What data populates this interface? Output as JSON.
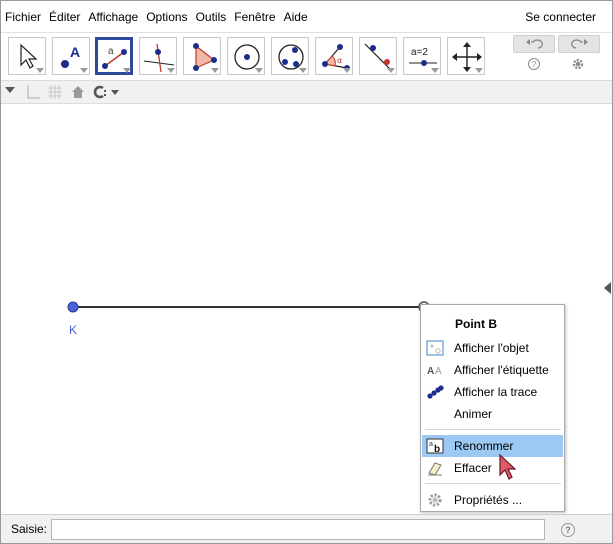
{
  "menubar": {
    "items": [
      {
        "label": "Fichier"
      },
      {
        "label": "Éditer"
      },
      {
        "label": "Affichage"
      },
      {
        "label": "Options"
      },
      {
        "label": "Outils"
      },
      {
        "label": "Fenêtre"
      },
      {
        "label": "Aide"
      }
    ],
    "connect_label": "Se connecter"
  },
  "toolbar": {
    "tools": [
      {
        "icon": "move-arrow-icon"
      },
      {
        "icon": "point-icon",
        "text": "A"
      },
      {
        "icon": "segment-icon",
        "text": "a",
        "selected": true
      },
      {
        "icon": "perpendicular-line-icon"
      },
      {
        "icon": "polygon-icon"
      },
      {
        "icon": "circle-center-point-icon"
      },
      {
        "icon": "circle-three-points-icon"
      },
      {
        "icon": "angle-icon",
        "text": "α"
      },
      {
        "icon": "reflect-line-icon"
      },
      {
        "icon": "slider-icon",
        "text": "a=2"
      },
      {
        "icon": "move-graphics-view-icon"
      }
    ],
    "undo_icon": "undo-icon",
    "redo_icon": "redo-icon",
    "help_icon": "help-icon",
    "settings_icon": "gear-icon"
  },
  "stylebar": {
    "icons": [
      "axes-icon",
      "grid-icon",
      "home-icon",
      "point-capture-icon"
    ]
  },
  "canvas": {
    "point_k_label": "K",
    "point_color": "#4a62d8"
  },
  "context_menu": {
    "title": "Point B",
    "items": [
      {
        "label": "Afficher l'objet",
        "icon": "show-object-icon"
      },
      {
        "label": "Afficher l'étiquette",
        "icon": "show-label-icon"
      },
      {
        "label": "Afficher la trace",
        "icon": "trace-icon"
      },
      {
        "label": "Animer",
        "icon": ""
      },
      {
        "label": "Renommer",
        "icon": "rename-icon",
        "highlighted": true
      },
      {
        "label": "Effacer",
        "icon": "eraser-icon"
      },
      {
        "label": "Propriétés ...",
        "icon": "gear-icon"
      }
    ],
    "highlight_color": "#9cc9f3"
  },
  "inputbar": {
    "label": "Saisie:",
    "value": "",
    "placeholder": ""
  }
}
